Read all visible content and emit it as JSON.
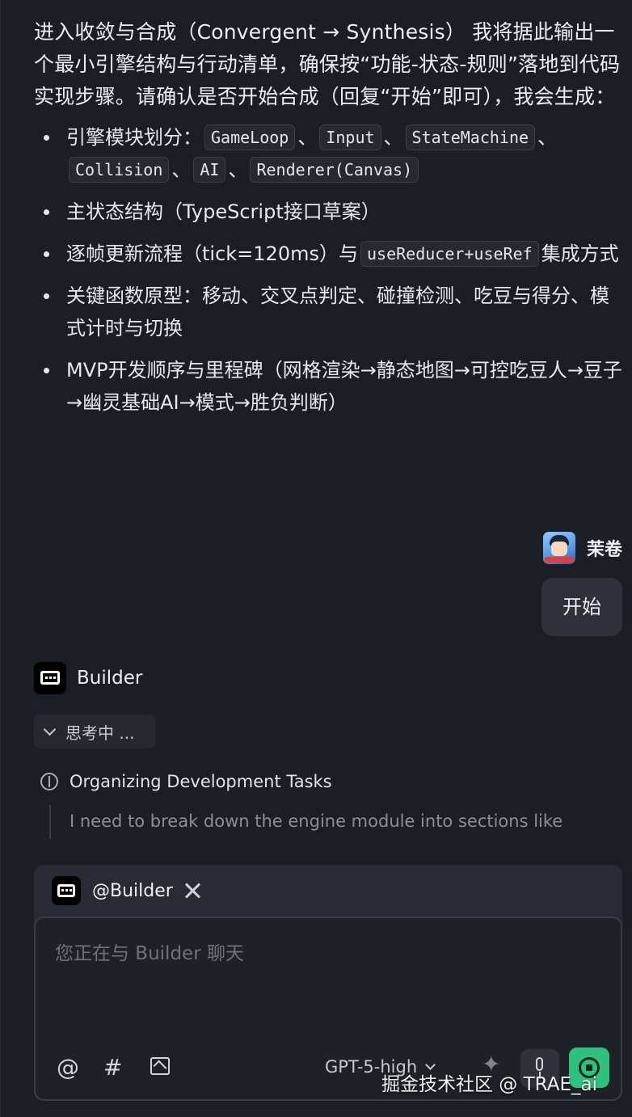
{
  "assistant_message": {
    "intro": "进入收敛与合成（Convergent → Synthesis） 我将据此输出一个最小引擎结构与行动清单，确保按“功能-状态-规则”落地到代码实现步骤。请确认是否开始合成（回复“开始”即可），我会生成：",
    "bullets": {
      "b1": {
        "text": "引擎模块划分：",
        "sep": "、",
        "code": [
          "GameLoop",
          "Input",
          "StateMachine",
          "Collision",
          "AI",
          "Renderer(Canvas)"
        ]
      },
      "b2": {
        "text": "主状态结构（TypeScript接口草案）"
      },
      "b3": {
        "before": "逐帧更新流程（tick=120ms）与",
        "code": "useReducer+useRef",
        "after": "集成方式"
      },
      "b4": {
        "text": "关键函数原型：移动、交叉点判定、碰撞检测、吃豆与得分、模式计时与切换"
      },
      "b5": {
        "text": "MVP开发顺序与里程碑（网格渲染→静态地图→可控吃豆人→豆子→幽灵基础AI→模式→胜负判断）"
      }
    }
  },
  "user_message": {
    "name": "茉卷",
    "text": "开始"
  },
  "builder": {
    "name": "Builder",
    "thinking_label": "思考中 ...",
    "task_title": "Organizing Development Tasks",
    "task_detail": "I need to break down the engine module into sections like"
  },
  "composer": {
    "mention_label": "@Builder",
    "placeholder": "您正在与 Builder 聊天",
    "at_symbol": "@",
    "hash_symbol": "#",
    "model": "GPT-5-high"
  },
  "watermark": "掘金技术社区 @ TRAE_ai",
  "icons": [
    "bot-icon",
    "tool-icon",
    "chevron-down-icon",
    "brain-icon",
    "at-icon",
    "hash-icon",
    "image-icon",
    "sparkle-icon",
    "mic-icon",
    "send-icon"
  ],
  "colors": {
    "background": "#1c1e25",
    "accent": "#2ec27e",
    "code_bg": "#262932"
  }
}
